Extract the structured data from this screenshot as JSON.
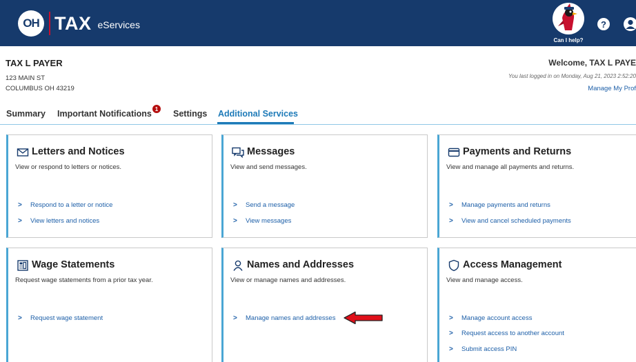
{
  "header": {
    "logo_oh": "OH",
    "logo_tax": "TAX",
    "logo_eservices": "eServices",
    "help_label": "Can I help?",
    "help_icon": "question-circle-icon",
    "user_icon": "user-circle-icon",
    "brand_color": "#163a6c",
    "accent_red": "#c8102e"
  },
  "account": {
    "name": "TAX L PAYER",
    "address_line1": "123 MAIN ST",
    "address_line2": "COLUMBUS OH 43219",
    "welcome": "Welcome, TAX L PAYE",
    "last_login": "You last logged in on Monday, Aug 21, 2023 2:52:20",
    "manage_profile": "Manage My Prof"
  },
  "tabs": [
    {
      "label": "Summary",
      "active": false
    },
    {
      "label": "Important Notifications",
      "active": false,
      "badge": "1"
    },
    {
      "label": "Settings",
      "active": false
    },
    {
      "label": "Additional Services",
      "active": true
    }
  ],
  "cards": {
    "letters": {
      "title": "Letters and Notices",
      "icon": "envelope-icon",
      "description": "View or respond to letters or notices.",
      "links": [
        "Respond to a letter or notice",
        "View letters and notices"
      ]
    },
    "messages": {
      "title": "Messages",
      "icon": "chat-bubbles-icon",
      "description": "View and send messages.",
      "links": [
        "Send a message",
        "View messages"
      ]
    },
    "payments": {
      "title": "Payments and Returns",
      "icon": "credit-card-icon",
      "description": "View and manage all payments and returns.",
      "links": [
        "Manage payments and returns",
        "View and cancel scheduled payments"
      ]
    },
    "wage": {
      "title": "Wage Statements",
      "icon": "calculator-icon",
      "description": "Request wage statements from a prior tax year.",
      "links": [
        "Request wage statement"
      ]
    },
    "names": {
      "title": "Names and Addresses",
      "icon": "person-icon",
      "description": "View or manage names and addresses.",
      "links": [
        "Manage names and addresses"
      ]
    },
    "access": {
      "title": "Access Management",
      "icon": "shield-icon",
      "description": "View and manage access.",
      "links": [
        "Manage account access",
        "Request access to another account",
        "Submit access PIN"
      ]
    }
  },
  "colors": {
    "link": "#1d5fa8",
    "active_tab": "#1d7ab8",
    "card_accent": "#4aa6d4",
    "badge": "#b50f0f",
    "arrow": "#e0101a"
  }
}
